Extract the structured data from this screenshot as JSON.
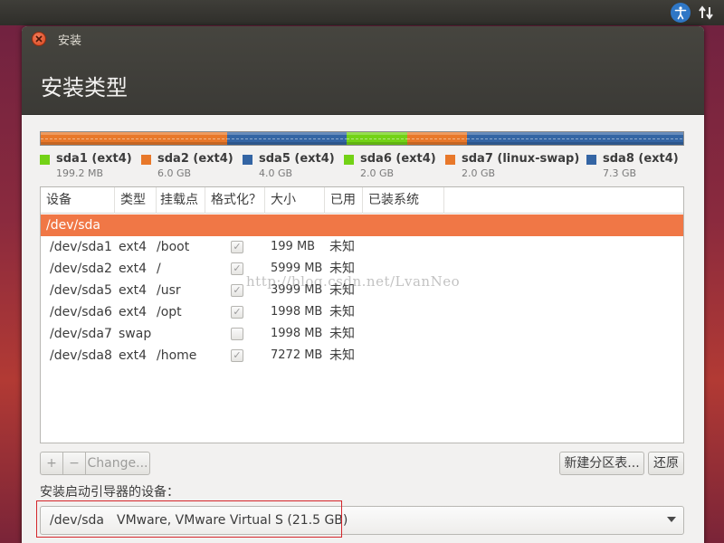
{
  "window": {
    "title": "安装",
    "heading": "安装类型"
  },
  "colors": {
    "green": "#73d216",
    "orange": "#e8782a",
    "blue": "#3465a4",
    "selection": "#f07746",
    "highlight_box": "#d4262b"
  },
  "partitions_bar": {
    "segments": [
      {
        "color": "orange",
        "fraction": 0.29
      },
      {
        "color": "blue",
        "fraction": 0.186
      },
      {
        "color": "green",
        "fraction": 0.094
      },
      {
        "color": "orange",
        "fraction": 0.094
      },
      {
        "color": "blue",
        "fraction": 0.336
      }
    ]
  },
  "legend": [
    {
      "name": "sda1 (ext4)",
      "size": "199.2 MB",
      "color": "#73d216"
    },
    {
      "name": "sda2 (ext4)",
      "size": "6.0 GB",
      "color": "#e8782a"
    },
    {
      "name": "sda5 (ext4)",
      "size": "4.0 GB",
      "color": "#3465a4"
    },
    {
      "name": "sda6 (ext4)",
      "size": "2.0 GB",
      "color": "#73d216"
    },
    {
      "name": "sda7 (linux-swap)",
      "size": "2.0 GB",
      "color": "#e8782a"
    },
    {
      "name": "sda8 (ext4)",
      "size": "7.3 GB",
      "color": "#3465a4"
    }
  ],
  "table": {
    "headers": [
      "设备",
      "类型",
      "挂载点",
      "格式化？",
      "大小",
      "已用",
      "已装系统"
    ],
    "device_row": "/dev/sda",
    "rows": [
      {
        "device": "/dev/sda1",
        "type": "ext4",
        "mount": "/boot",
        "format": true,
        "size": "199 MB",
        "used": "未知"
      },
      {
        "device": "/dev/sda2",
        "type": "ext4",
        "mount": "/",
        "format": true,
        "size": "5999 MB",
        "used": "未知"
      },
      {
        "device": "/dev/sda5",
        "type": "ext4",
        "mount": "/usr",
        "format": true,
        "size": "3999 MB",
        "used": "未知"
      },
      {
        "device": "/dev/sda6",
        "type": "ext4",
        "mount": "/opt",
        "format": true,
        "size": "1998 MB",
        "used": "未知"
      },
      {
        "device": "/dev/sda7",
        "type": "swap",
        "mount": "",
        "format": false,
        "size": "1998 MB",
        "used": "未知"
      },
      {
        "device": "/dev/sda8",
        "type": "ext4",
        "mount": "/home",
        "format": true,
        "size": "7272 MB",
        "used": "未知"
      }
    ]
  },
  "toolbar": {
    "add_label": "+",
    "remove_label": "−",
    "change_label": "Change...",
    "new_table_label": "新建分区表...",
    "revert_label": "还原"
  },
  "boot_loader": {
    "label": "安装启动引导器的设备：",
    "selected_device": "/dev/sda",
    "selected_desc": "VMware, VMware Virtual S (21.5 GB)"
  },
  "watermark": "http://blog.csdn.net/LvanNeo"
}
